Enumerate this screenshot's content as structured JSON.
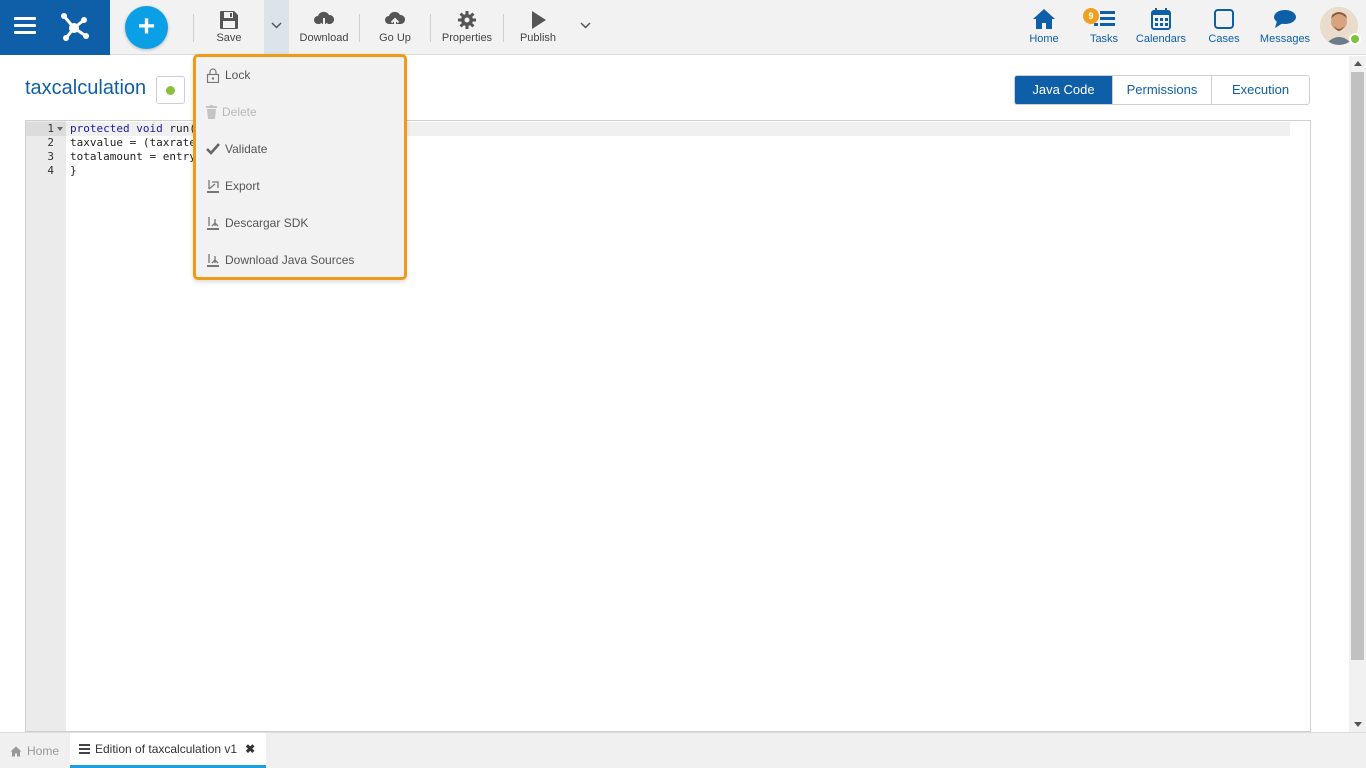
{
  "toolbar": {
    "save_label": "Save",
    "download_label": "Download",
    "goup_label": "Go Up",
    "properties_label": "Properties",
    "publish_label": "Publish"
  },
  "nav": {
    "home": "Home",
    "tasks": "Tasks",
    "tasks_badge": "9",
    "calendars": "Calendars",
    "cases": "Cases",
    "messages": "Messages"
  },
  "page": {
    "title": "taxcalculation",
    "status_color": "#8cbf3f"
  },
  "tabs": [
    {
      "label": "Java Code",
      "active": true
    },
    {
      "label": "Permissions",
      "active": false
    },
    {
      "label": "Execution",
      "active": false
    }
  ],
  "editor": {
    "lines": [
      {
        "num": "1",
        "keyword": "protected void",
        "text": " run("
      },
      {
        "num": "2",
        "keyword": "",
        "text": "taxvalue = (taxrate"
      },
      {
        "num": "3",
        "keyword": "",
        "text": "totalamount = entry"
      },
      {
        "num": "4",
        "keyword": "",
        "text": "}"
      }
    ]
  },
  "dropdown": {
    "items": [
      {
        "label": "Lock",
        "icon": "lock-icon",
        "disabled": false
      },
      {
        "label": "Delete",
        "icon": "trash-icon",
        "disabled": true
      },
      {
        "label": "Validate",
        "icon": "check-icon",
        "disabled": false
      },
      {
        "label": "Export",
        "icon": "export-icon",
        "disabled": false
      },
      {
        "label": "Descargar SDK",
        "icon": "sdk-download-icon",
        "disabled": false
      },
      {
        "label": "Download Java Sources",
        "icon": "source-download-icon",
        "disabled": false
      }
    ]
  },
  "bottom_tabs": {
    "home": "Home",
    "edition": "Edition of taxcalculation v1"
  },
  "colors": {
    "brand": "#0f5fa8",
    "accent": "#0b9fe6",
    "highlight": "#f09a1a"
  }
}
